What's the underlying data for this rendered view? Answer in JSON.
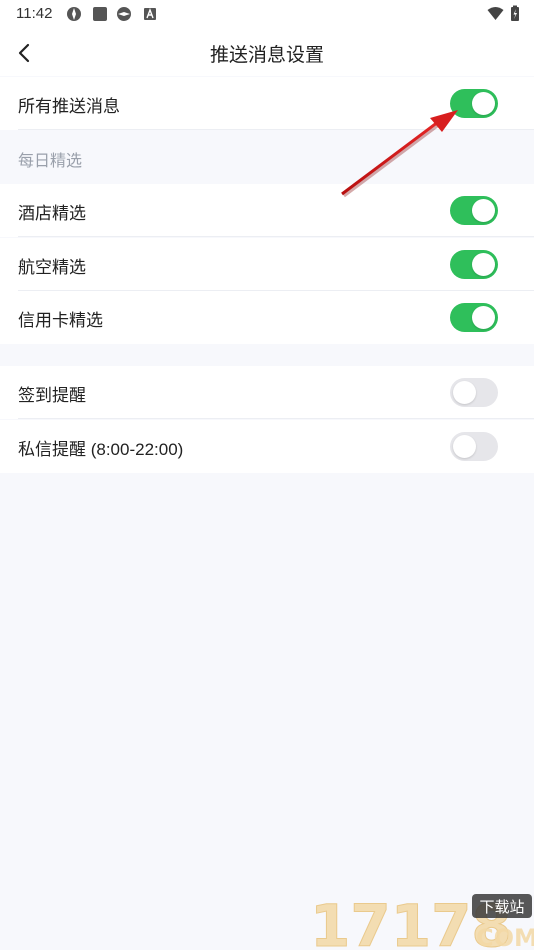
{
  "status_bar": {
    "time": "11:42"
  },
  "header": {
    "title": "推送消息设置"
  },
  "all_push": {
    "label": "所有推送消息",
    "enabled": true
  },
  "daily_picks": {
    "section_title": "每日精选",
    "items": [
      {
        "label": "酒店精选",
        "enabled": true
      },
      {
        "label": "航空精选",
        "enabled": true
      },
      {
        "label": "信用卡精选",
        "enabled": true
      }
    ]
  },
  "reminders": {
    "items": [
      {
        "label": "签到提醒",
        "enabled": false
      },
      {
        "label": "私信提醒 (8:00-22:00)",
        "enabled": false
      }
    ]
  },
  "watermark": {
    "text": "17178",
    "badge": "下载站",
    "domain": "COM"
  },
  "colors": {
    "toggle_on": "#2fbf5b",
    "toggle_off": "#e6e6ea",
    "annotation_arrow": "#d81e1e"
  }
}
